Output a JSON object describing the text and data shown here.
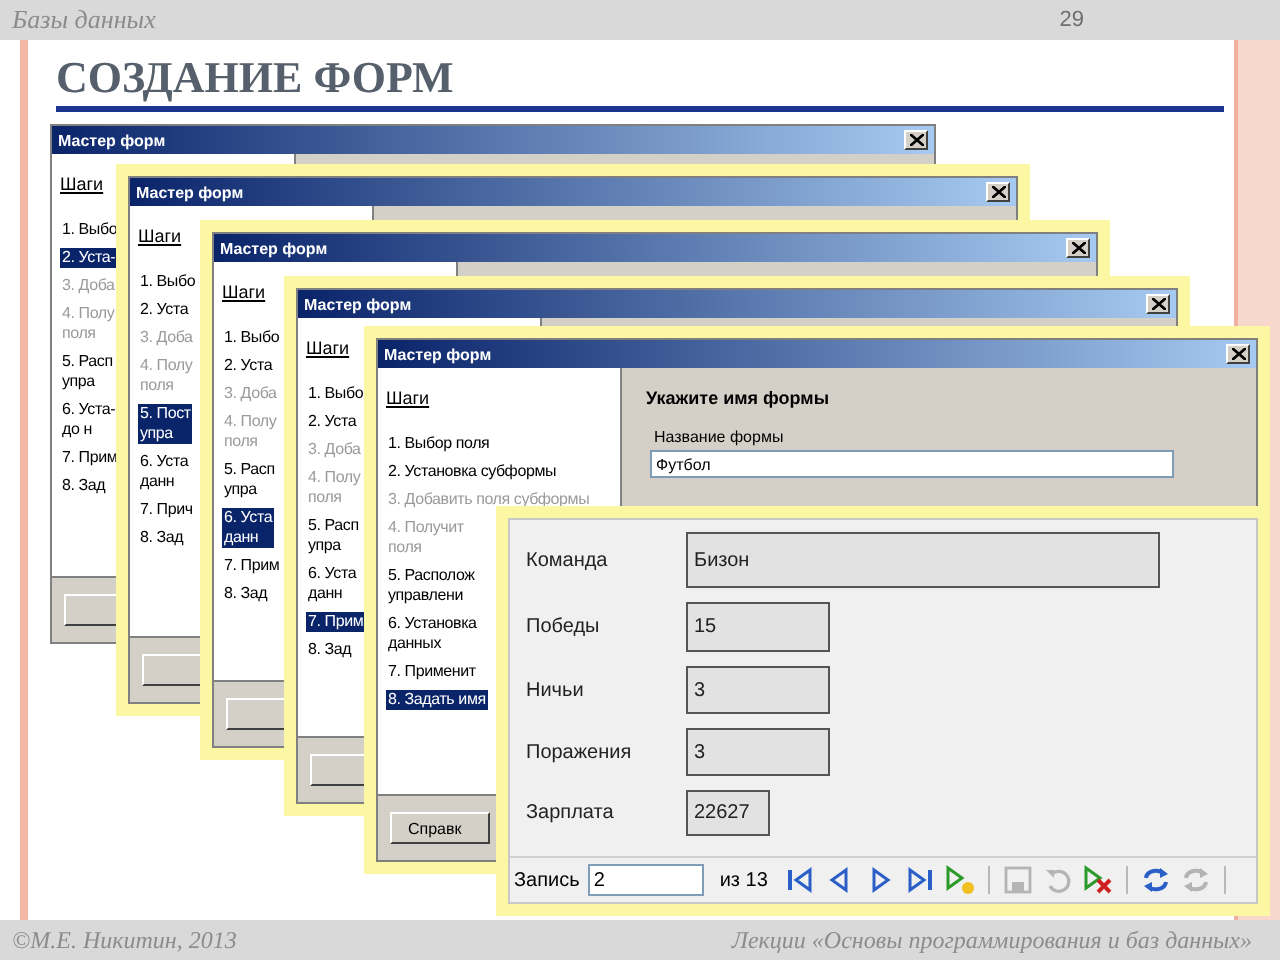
{
  "header": {
    "section": "Базы данных",
    "page": "29"
  },
  "title": "СОЗДАНИЕ ФОРМ",
  "wizards": [
    {
      "title": "Мастер форм",
      "steps_heading": "Шаги",
      "steps": [
        {
          "label": "1. Выбо",
          "selected": false,
          "disabled": false
        },
        {
          "label": "2. Уста-",
          "selected": true,
          "disabled": false
        },
        {
          "label": "3. Доба",
          "selected": false,
          "disabled": true
        },
        {
          "label": "4. Полу\nполя",
          "selected": false,
          "disabled": true
        },
        {
          "label": "5. Расп\nупра",
          "selected": false,
          "disabled": false
        },
        {
          "label": "6. Уста-\nдо н",
          "selected": false,
          "disabled": false
        },
        {
          "label": "7. Прим",
          "selected": false,
          "disabled": false
        },
        {
          "label": "8. Зад",
          "selected": false,
          "disabled": false
        }
      ]
    },
    {
      "title": "Мастер форм",
      "steps_heading": "Шаги",
      "steps": [
        {
          "label": "1. Выбо",
          "selected": false,
          "disabled": false
        },
        {
          "label": "2. Уста",
          "selected": false,
          "disabled": false
        },
        {
          "label": "3. Доба",
          "selected": false,
          "disabled": true
        },
        {
          "label": "4. Полу\nполя",
          "selected": false,
          "disabled": true
        },
        {
          "label": "5. Пост\nупра",
          "selected": true,
          "disabled": false
        },
        {
          "label": "6. Уста\nданн",
          "selected": false,
          "disabled": false
        },
        {
          "label": "7. Прич",
          "selected": false,
          "disabled": false
        },
        {
          "label": "8. Зад",
          "selected": false,
          "disabled": false
        }
      ]
    },
    {
      "title": "Мастер форм",
      "steps_heading": "Шаги",
      "steps": [
        {
          "label": "1. Выбо",
          "selected": false,
          "disabled": false
        },
        {
          "label": "2. Уста",
          "selected": false,
          "disabled": false
        },
        {
          "label": "3. Доба",
          "selected": false,
          "disabled": true
        },
        {
          "label": "4. Полу\nполя",
          "selected": false,
          "disabled": true
        },
        {
          "label": "5. Расп\nупра",
          "selected": false,
          "disabled": false
        },
        {
          "label": "6. Уста\nданн",
          "selected": true,
          "disabled": false
        },
        {
          "label": "7. Прим",
          "selected": false,
          "disabled": false
        },
        {
          "label": "8. Зад",
          "selected": false,
          "disabled": false
        }
      ]
    },
    {
      "title": "Мастер форм",
      "steps_heading": "Шаги",
      "steps": [
        {
          "label": "1. Выбо",
          "selected": false,
          "disabled": false
        },
        {
          "label": "2. Уста",
          "selected": false,
          "disabled": false
        },
        {
          "label": "3. Доба",
          "selected": false,
          "disabled": true
        },
        {
          "label": "4. Полу\nполя",
          "selected": false,
          "disabled": true
        },
        {
          "label": "5. Расп\nупра",
          "selected": false,
          "disabled": false
        },
        {
          "label": "6. Уста\nданн",
          "selected": false,
          "disabled": false
        },
        {
          "label": "7. Прим",
          "selected": true,
          "disabled": false
        },
        {
          "label": "8. Зад",
          "selected": false,
          "disabled": false
        }
      ]
    },
    {
      "title": "Мастер форм",
      "steps_heading": "Шаги",
      "steps": [
        {
          "label": "1. Выбор поля",
          "selected": false,
          "disabled": false
        },
        {
          "label": "2. Установка субформы",
          "selected": false,
          "disabled": false
        },
        {
          "label": "3. Добавить поля субформы",
          "selected": false,
          "disabled": true
        },
        {
          "label": "4. Получит\nполя",
          "selected": false,
          "disabled": true
        },
        {
          "label": "5. Располож\nуправлени",
          "selected": false,
          "disabled": false
        },
        {
          "label": "6. Установка\nданных",
          "selected": false,
          "disabled": false
        },
        {
          "label": "7. Применит",
          "selected": false,
          "disabled": false
        },
        {
          "label": "8. Задать имя",
          "selected": true,
          "disabled": false
        }
      ],
      "page_heading": "Укажите имя формы",
      "field_label": "Название формы",
      "field_value": "Футбол",
      "button": "Справк"
    }
  ],
  "form": {
    "fields": [
      {
        "label": "Команда",
        "value": "Бизон"
      },
      {
        "label": "Победы",
        "value": "15"
      },
      {
        "label": "Ничьи",
        "value": "3"
      },
      {
        "label": "Поражения",
        "value": "3"
      },
      {
        "label": "Зарплата",
        "value": "22627"
      }
    ],
    "navigator": {
      "label": "Запись",
      "record": "2",
      "total": "из 13",
      "button_groups": [
        [
          {
            "kind": "first",
            "disabled": false
          },
          {
            "kind": "prev",
            "disabled": false
          },
          {
            "kind": "next",
            "disabled": false
          },
          {
            "kind": "last",
            "disabled": false
          },
          {
            "kind": "new",
            "disabled": false
          }
        ],
        [
          {
            "kind": "save",
            "disabled": true
          },
          {
            "kind": "undo",
            "disabled": true
          },
          {
            "kind": "delete",
            "disabled": false
          }
        ],
        [
          {
            "kind": "refresh",
            "disabled": false
          },
          {
            "kind": "refresh",
            "disabled": true
          }
        ]
      ]
    }
  },
  "footer": {
    "author": "©М.Е. Никитин, 2013",
    "course": "Лекции «Основы программирования и баз данных»"
  }
}
